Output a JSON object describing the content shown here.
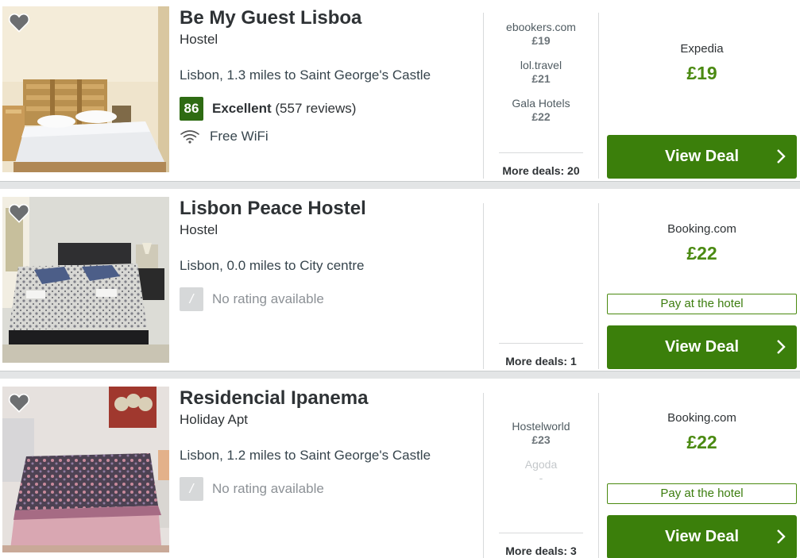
{
  "results": [
    {
      "name": "Be My Guest Lisboa",
      "type": "Hostel",
      "location": "Lisbon, 1.3 miles to Saint George's Castle",
      "rating": {
        "score": "86",
        "label": "Excellent",
        "reviews": "(557 reviews)"
      },
      "amenity": "Free WiFi",
      "deals": [
        {
          "provider": "ebookers.com",
          "price": "£19"
        },
        {
          "provider": "lol.travel",
          "price": "£21"
        },
        {
          "provider": "Gala Hotels",
          "price": "£22"
        }
      ],
      "more_deals": "More deals: 20",
      "best": {
        "provider": "Expedia",
        "price": "£19"
      },
      "cta": "View Deal"
    },
    {
      "name": "Lisbon Peace Hostel",
      "type": "Hostel",
      "location": "Lisbon, 0.0 miles to City centre",
      "rating": {
        "score": "/",
        "label": "No rating available"
      },
      "more_deals": "More deals: 1",
      "best": {
        "provider": "Booking.com",
        "price": "£22"
      },
      "pay_at_hotel": "Pay at the hotel",
      "cta": "View Deal"
    },
    {
      "name": "Residencial Ipanema",
      "type": "Holiday Apt",
      "location": "Lisbon, 1.2 miles to Saint George's Castle",
      "rating": {
        "score": "/",
        "label": "No rating available"
      },
      "deals": [
        {
          "provider": "Hostelworld",
          "price": "£23"
        },
        {
          "provider": "Agoda",
          "price": "-"
        }
      ],
      "more_deals": "More deals: 3",
      "best": {
        "provider": "Booking.com",
        "price": "£22"
      },
      "pay_at_hotel": "Pay at the hotel",
      "cta": "View Deal"
    }
  ],
  "icons": {
    "favorite": "heart-icon",
    "wifi": "wifi-icon",
    "arrow": "chevron-right-icon"
  },
  "colors": {
    "price_green": "#4b8a12",
    "button_green": "#3b7f0b",
    "score_green": "#2e6b13"
  }
}
